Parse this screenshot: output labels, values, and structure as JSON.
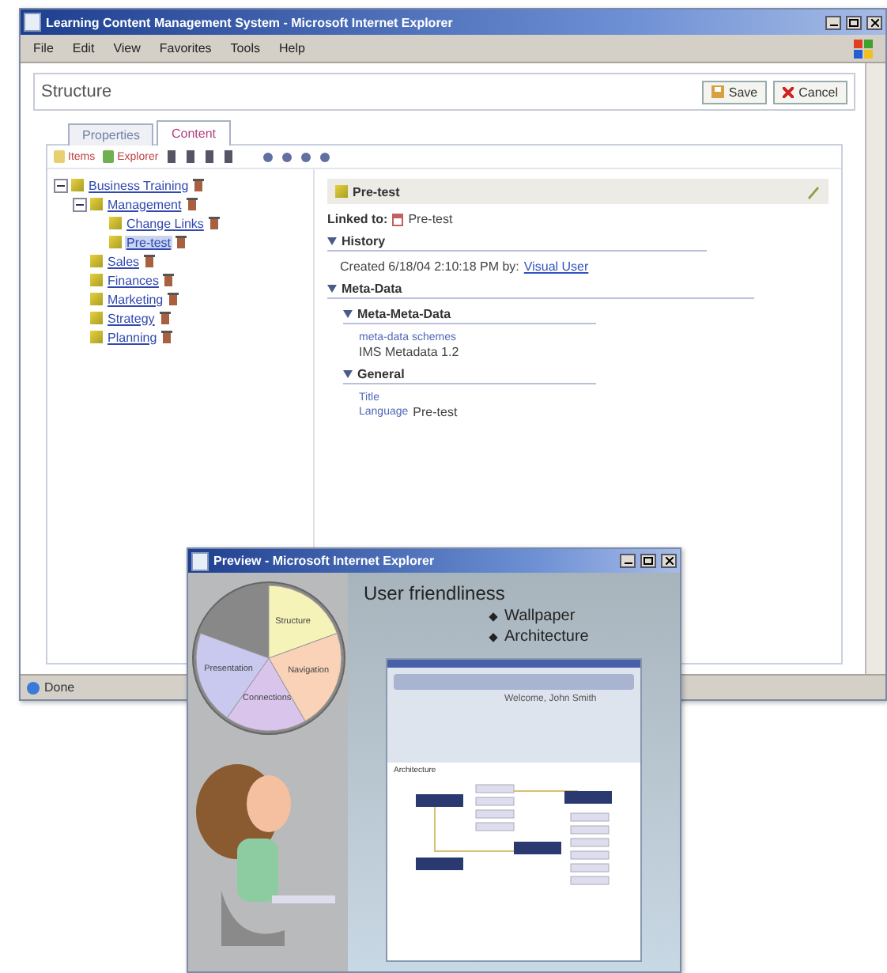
{
  "main_window": {
    "title": "Learning Content Management System - Microsoft Internet Explorer",
    "menu": [
      "File",
      "Edit",
      "View",
      "Favorites",
      "Tools",
      "Help"
    ],
    "status": "Done"
  },
  "header": {
    "title": "Structure",
    "buttons": [
      {
        "label": "Save",
        "kind": "save"
      },
      {
        "label": "Cancel",
        "kind": "cancel"
      }
    ]
  },
  "tabs": [
    {
      "label": "Properties",
      "selected": false
    },
    {
      "label": "Content",
      "selected": true
    }
  ],
  "toolbar": [
    {
      "label": "Items"
    },
    {
      "label": "Explorer"
    }
  ],
  "tree": [
    {
      "label": "Business Training",
      "selected": false,
      "expanded": true,
      "children": [
        {
          "label": "Management",
          "selected": false,
          "expanded": true,
          "children": [
            {
              "label": "Change Links",
              "selected": false
            },
            {
              "label": "Pre-test",
              "selected": true
            }
          ]
        },
        {
          "label": "Sales",
          "selected": false
        },
        {
          "label": "Finances",
          "selected": false
        },
        {
          "label": "Marketing",
          "selected": false
        },
        {
          "label": "Strategy",
          "selected": false
        },
        {
          "label": "Planning",
          "selected": false
        }
      ]
    }
  ],
  "detail": {
    "title": "Pre-test",
    "linked_label": "Linked to:",
    "linked_value": "Pre-test",
    "history": {
      "title": "History",
      "expanded": true,
      "text": "Created 6/18/04 2:10:18 PM by:",
      "link": "Visual User"
    },
    "meta": {
      "title": "Meta-Data",
      "expanded": true,
      "subsections": [
        {
          "title": "Meta-Meta-Data",
          "expanded": true,
          "lines": [
            {
              "kind": "label",
              "text": "meta-data schemes"
            },
            {
              "kind": "value",
              "text": "IMS Metadata 1.2"
            }
          ]
        },
        {
          "title": "General",
          "expanded": true,
          "lines": [
            {
              "kind": "label",
              "text": "Title"
            },
            {
              "kind": "pair",
              "label": "Language",
              "value": "Pre-test"
            }
          ]
        }
      ]
    }
  },
  "preview": {
    "title": "Preview - Microsoft Internet Explorer",
    "heading": "User friendliness",
    "bullets": [
      "Wallpaper",
      "Architecture"
    ],
    "pie_labels": [
      {
        "label": "Structure",
        "color": "#f6f3b8"
      },
      {
        "label": "Navigation",
        "color": "#f9d2b8"
      },
      {
        "label": "Connections",
        "color": "#d9c4ec"
      },
      {
        "label": "Presentation",
        "color": "#c9c8ee"
      }
    ],
    "inner_screenshot": {
      "welcome": "Welcome, John Smith",
      "diagram_title": "Architecture"
    }
  }
}
